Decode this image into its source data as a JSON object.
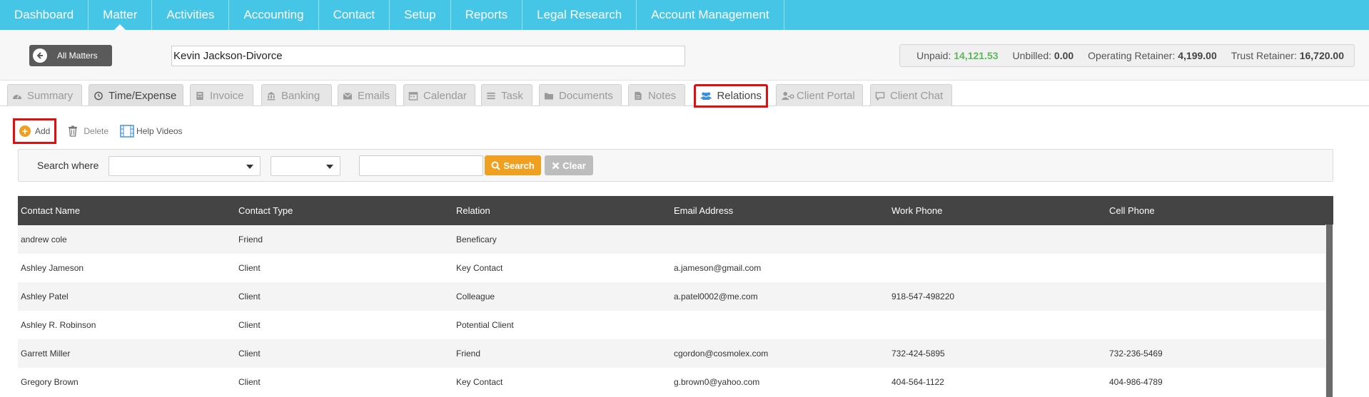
{
  "nav": {
    "items": [
      {
        "label": "Dashboard"
      },
      {
        "label": "Matter"
      },
      {
        "label": "Activities"
      },
      {
        "label": "Accounting"
      },
      {
        "label": "Contact"
      },
      {
        "label": "Setup"
      },
      {
        "label": "Reports"
      },
      {
        "label": "Legal Research"
      },
      {
        "label": "Account Management"
      }
    ],
    "active": "Matter"
  },
  "matter": {
    "all_matters_label": "All Matters",
    "name": "Kevin Jackson-Divorce"
  },
  "summary": {
    "unpaid_label": "Unpaid:",
    "unpaid_value": "14,121.53",
    "unbilled_label": "Unbilled:",
    "unbilled_value": "0.00",
    "operating_label": "Operating Retainer:",
    "operating_value": "4,199.00",
    "trust_label": "Trust Retainer:",
    "trust_value": "16,720.00"
  },
  "tabs": [
    {
      "label": "Summary",
      "icon": "dashboard-icon"
    },
    {
      "label": "Time/Expense",
      "icon": "clock-icon"
    },
    {
      "label": "Invoice",
      "icon": "calculator-icon"
    },
    {
      "label": "Banking",
      "icon": "bank-icon"
    },
    {
      "label": "Emails",
      "icon": "envelope-icon"
    },
    {
      "label": "Calendar",
      "icon": "calendar-icon"
    },
    {
      "label": "Task",
      "icon": "task-list-icon"
    },
    {
      "label": "Documents",
      "icon": "folder-icon"
    },
    {
      "label": "Notes",
      "icon": "file-icon"
    },
    {
      "label": "Relations",
      "icon": "users-icon"
    },
    {
      "label": "Client Portal",
      "icon": "user-key-icon"
    },
    {
      "label": "Client Chat",
      "icon": "chat-icon"
    }
  ],
  "toolbar": {
    "add_label": "Add",
    "delete_label": "Delete",
    "help_label": "Help Videos"
  },
  "search": {
    "where_label": "Search where",
    "search_label": "Search",
    "clear_label": "Clear"
  },
  "table": {
    "columns": [
      "Contact Name",
      "Contact Type",
      "Relation",
      "Email Address",
      "Work Phone",
      "Cell Phone"
    ],
    "rows": [
      [
        "andrew cole",
        "Friend",
        "Beneficary",
        "",
        "",
        ""
      ],
      [
        "Ashley Jameson",
        "Client",
        "Key Contact",
        "a.jameson@gmail.com",
        "",
        ""
      ],
      [
        "Ashley Patel",
        "Client",
        "Colleague",
        "a.patel0002@me.com",
        "918-547-498220",
        ""
      ],
      [
        "Ashley R. Robinson",
        "Client",
        "Potential Client",
        "",
        "",
        ""
      ],
      [
        "Garrett Miller",
        "Client",
        "Friend",
        "cgordon@cosmolex.com",
        "732-424-5895",
        "732-236-5469"
      ],
      [
        "Gregory Brown",
        "Client",
        "Key Contact",
        "g.brown0@yahoo.com",
        "404-564-1122",
        "404-986-4789"
      ]
    ]
  },
  "colors": {
    "nav_bg": "#45c6e6",
    "accent_orange": "#f0a020",
    "highlight_red": "#e01010",
    "table_header": "#444444",
    "unpaid_green": "#5cb85c"
  }
}
